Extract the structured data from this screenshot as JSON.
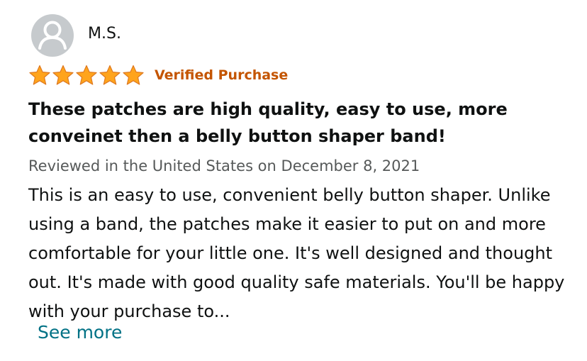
{
  "review": {
    "author": "M.S.",
    "rating": 5,
    "rating_max": 5,
    "verified_label": "Verified Purchase",
    "title": "These patches are high quality, easy to use, more conveinet then a belly button shaper band!",
    "date_line": "Reviewed in the United States on December 8, 2021",
    "body": "This is an easy to use, convenient belly button shaper. Unlike using a band, the patches make it easier to put on and more comfortable for your little one. It's well designed and thought out. It's made with good quality safe materials. You'll be happy with your purchase to...",
    "see_more_label": "See more"
  },
  "icons": {
    "avatar": "default-user-avatar-icon",
    "star": "filled-star-icon"
  },
  "colors": {
    "star_fill": "#ffa41c",
    "star_stroke": "#de7921",
    "verified": "#c45500",
    "link": "#007185",
    "muted": "#565959"
  }
}
